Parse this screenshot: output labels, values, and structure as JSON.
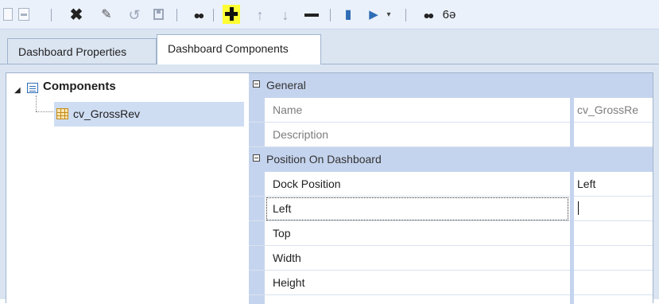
{
  "toolbar": {
    "icons": [
      "new-icon",
      "document-icon",
      "delete-icon",
      "edit-icon",
      "undo-icon",
      "save-icon",
      "binoculars-icon",
      "add-icon",
      "move-up-icon",
      "move-down-icon",
      "remove-icon",
      "import-icon",
      "export-icon",
      "dropdown-arrow-icon",
      "find-replace-icon",
      "glasses-icon"
    ],
    "delete_glyph": "✖",
    "edit_glyph": "✎",
    "undo_glyph": "↺",
    "binoculars_glyph": "●●",
    "up_glyph": "↑",
    "down_glyph": "↓",
    "import_glyph": "▮",
    "export_glyph": "▶",
    "dropdown_glyph": "▾",
    "find_glyph": "●●",
    "glasses_glyph": "6ə",
    "add_highlight_color": "#ffff33"
  },
  "tabs": [
    {
      "label": "Dashboard Properties",
      "active": false
    },
    {
      "label": "Dashboard Components",
      "active": true
    }
  ],
  "tree": {
    "root_label": "Components",
    "expand_glyph": "◢",
    "children": [
      {
        "label": "cv_GrossRev",
        "selected": true
      }
    ]
  },
  "property_grid": {
    "categories": [
      {
        "label": "General",
        "properties": [
          {
            "name": "Name",
            "value": "cv_GrossRe",
            "readonly": true
          },
          {
            "name": "Description",
            "value": "",
            "readonly": true
          }
        ]
      },
      {
        "label": "Position On Dashboard",
        "properties": [
          {
            "name": "Dock Position",
            "value": "Left",
            "readonly": false
          },
          {
            "name": "Left",
            "value": "",
            "readonly": false,
            "editing": true
          },
          {
            "name": "Top",
            "value": "",
            "readonly": false
          },
          {
            "name": "Width",
            "value": "",
            "readonly": false
          },
          {
            "name": "Height",
            "value": "",
            "readonly": false
          }
        ]
      }
    ]
  },
  "colors": {
    "toolbar_bg": "#eaf1fb",
    "tab_area_bg": "#dbe5f2",
    "category_bg": "#c5d4ee",
    "selection_bg": "#cfddf3"
  }
}
